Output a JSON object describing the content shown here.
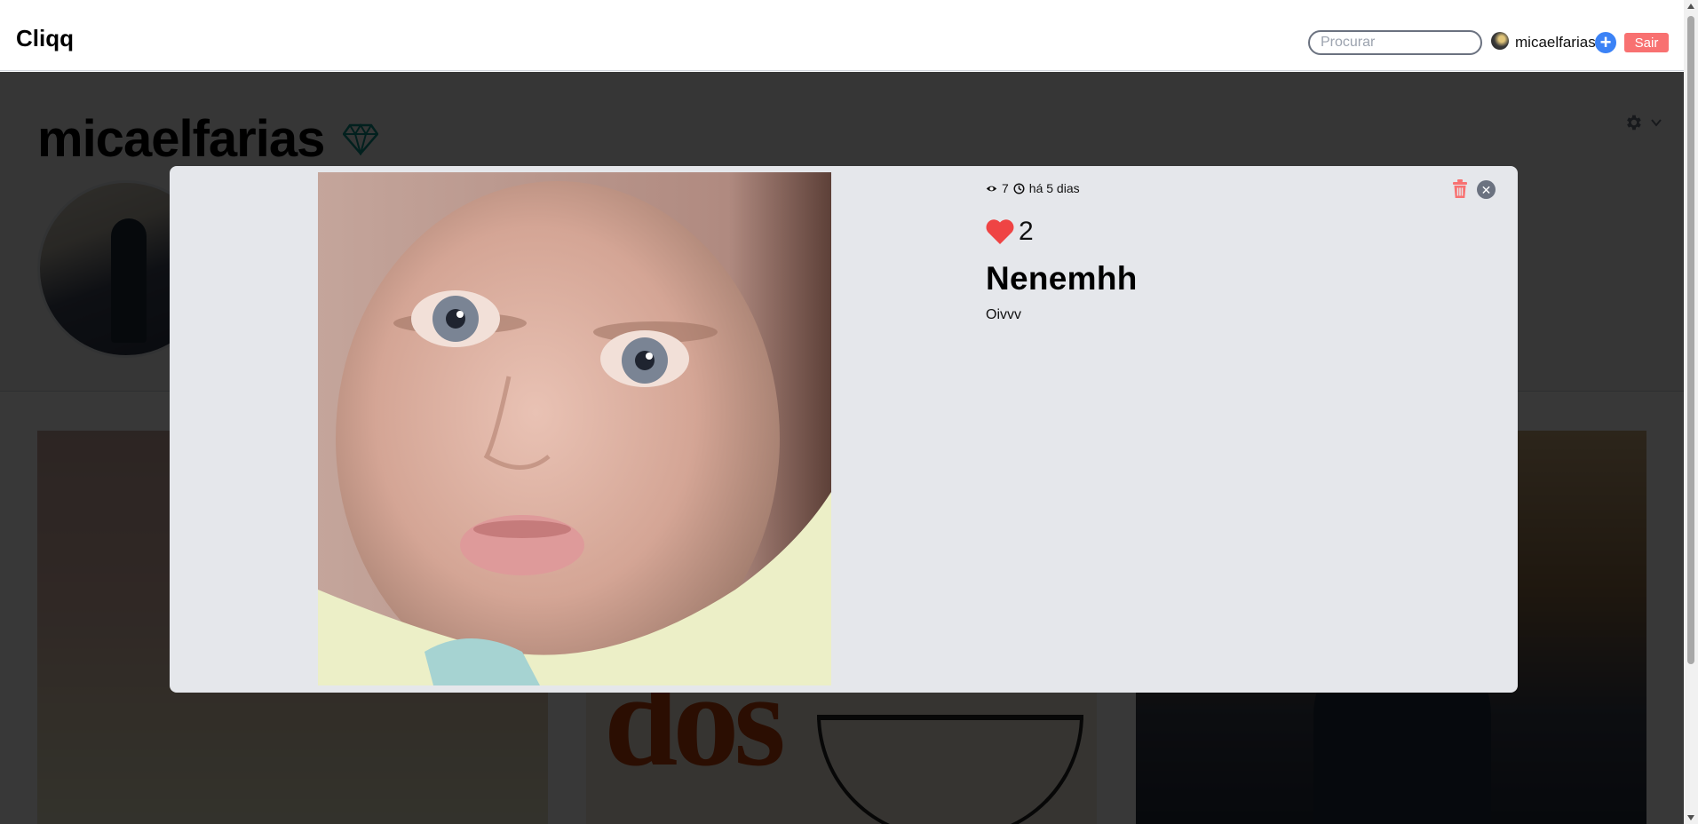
{
  "app": {
    "brand": "Cliqq"
  },
  "header": {
    "search_placeholder": "Procurar",
    "username": "micaelfarias",
    "add_label": "+",
    "logout_label": "Sair"
  },
  "profile": {
    "name": "micaelfarias",
    "badge_icon": "diamond-icon",
    "settings_icon": "gear-icon"
  },
  "modal": {
    "views": "7",
    "posted": "há 5 dias",
    "likes": "2",
    "title": "Nenemhh",
    "description": "Oivvv",
    "close_label": "✕"
  },
  "colors": {
    "accent_blue": "#3b82f6",
    "logout_red": "#f87171",
    "like_red": "#ef4444",
    "trash_red": "#f87171",
    "diamond_teal": "#0d9488",
    "modal_bg": "#e5e7eb"
  }
}
